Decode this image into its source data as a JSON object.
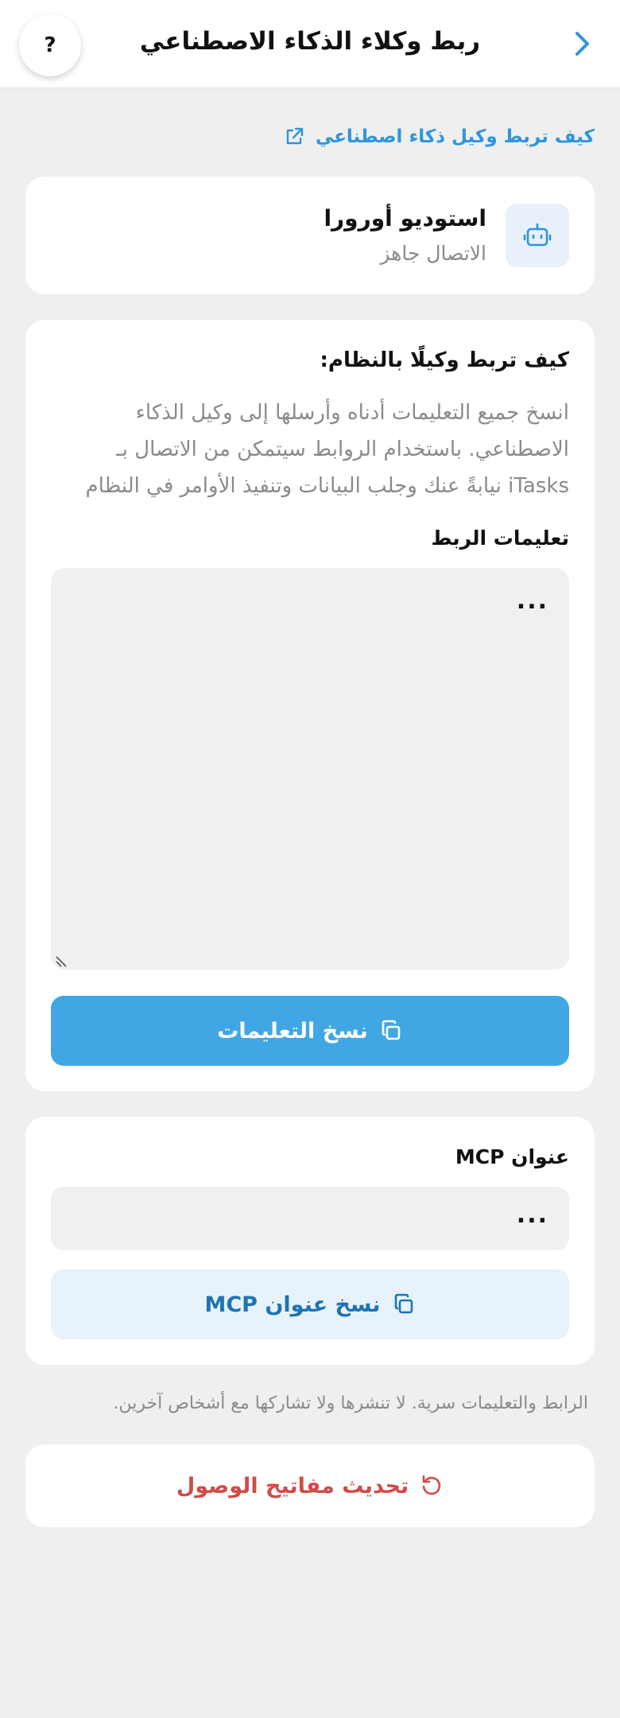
{
  "header": {
    "title": "ربط وكلاء الذكاء الاصطناعي",
    "help_label": "?",
    "back_icon": "chevron-right-icon"
  },
  "guide_link": {
    "label": "كيف تربط وكيل ذكاء اصطناعي",
    "icon": "external-link-icon"
  },
  "agent": {
    "name": "استوديو أورورا",
    "status": "الاتصال جاهز",
    "icon": "robot-icon"
  },
  "instructions": {
    "title": "كيف تربط وكيلًا بالنظام:",
    "description": "انسخ جميع التعليمات أدناه وأرسلها إلى وكيل الذكاء الاصطناعي. باستخدام الروابط سيتمكن من الاتصال بـ iTasks نيابةً عنك وجلب البيانات وتنفيذ الأوامر في النظام",
    "label": "تعليمات الربط",
    "value": "...",
    "copy_button": "نسخ التعليمات"
  },
  "mcp": {
    "label": "عنوان MCP",
    "value": "...",
    "copy_button": "نسخ عنوان MCP"
  },
  "warning": "الرابط والتعليمات سرية. لا تنشرها ولا تشاركها مع أشخاص آخرين.",
  "refresh_button": "تحديث مفاتيح الوصول",
  "colors": {
    "accent": "#41a7e4",
    "link": "#2f95dc",
    "danger": "#d14b47",
    "background": "#efefef"
  }
}
